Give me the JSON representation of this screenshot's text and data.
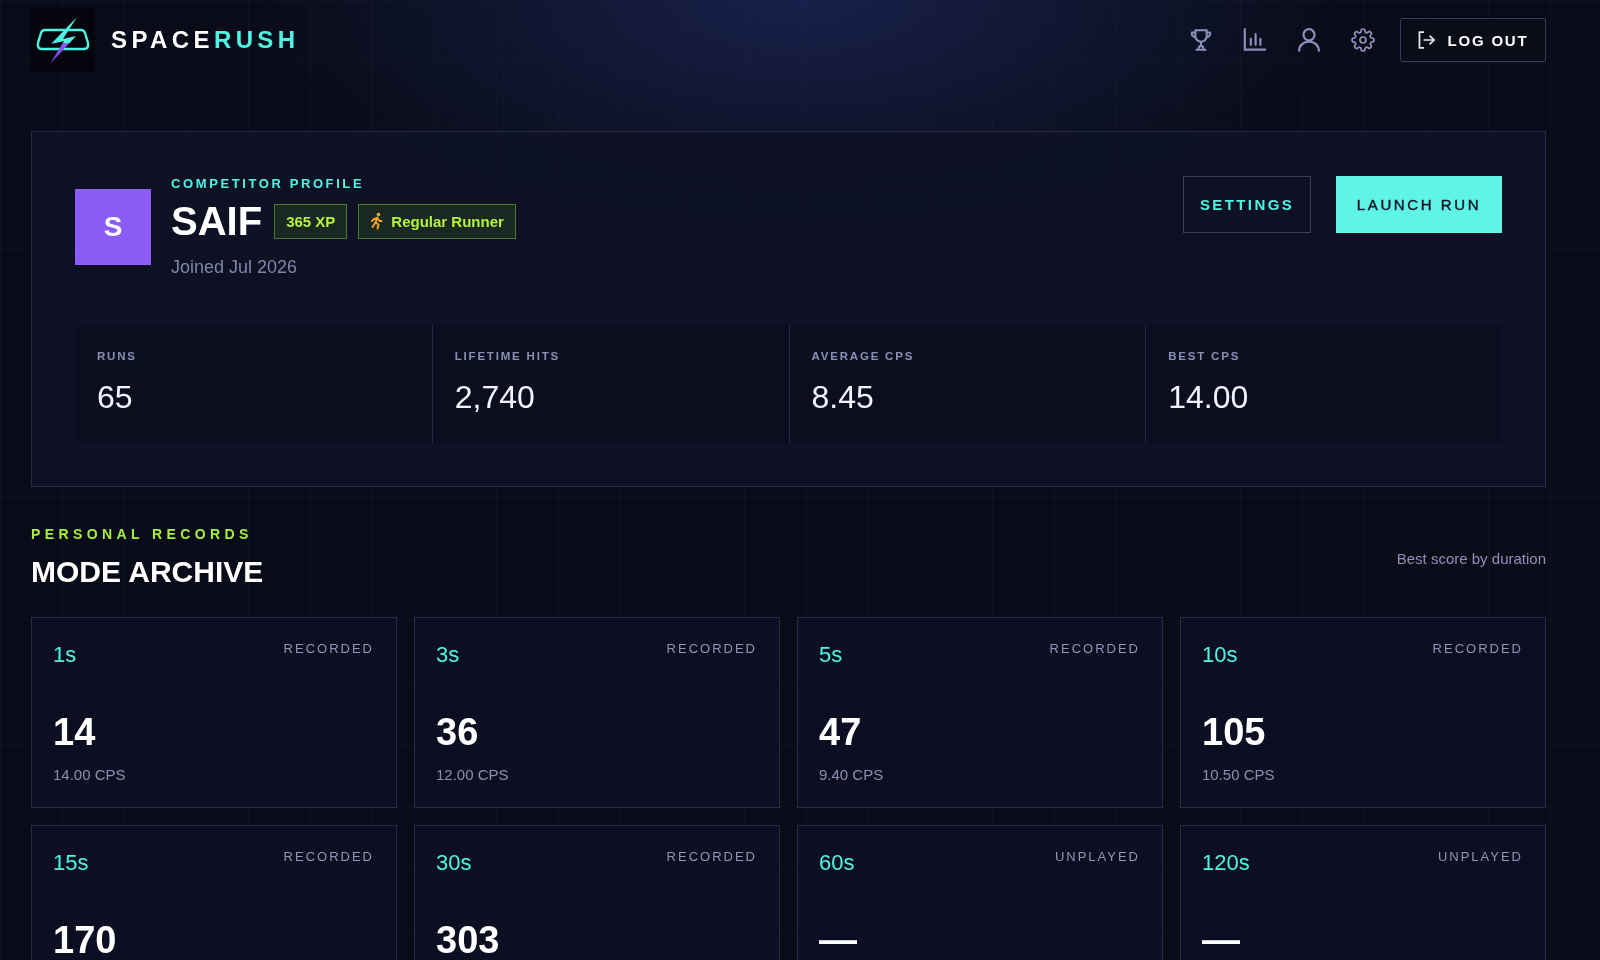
{
  "header": {
    "brand": [
      {
        "text": "SPACE",
        "accent": false
      },
      {
        "text": "RUSH",
        "accent": true
      }
    ],
    "logout_button": "LOG OUT"
  },
  "profile": {
    "eyebrow": "COMPETITOR PROFILE",
    "avatar_initial": "S",
    "name": "SAIF",
    "badges": [
      {
        "kind": "xp",
        "label": "365 XP"
      },
      {
        "kind": "rank",
        "label": "Regular Runner"
      }
    ],
    "joined": "Joined Jul 2026",
    "buttons": [
      {
        "kind": "secondary",
        "label": "SETTINGS"
      },
      {
        "kind": "primary",
        "label": "LAUNCH RUN"
      }
    ],
    "stats": [
      {
        "label": "RUNS",
        "value": "65"
      },
      {
        "label": "LIFETIME HITS",
        "value": "2,740"
      },
      {
        "label": "AVERAGE CPS",
        "value": "8.45"
      },
      {
        "label": "BEST CPS",
        "value": "14.00"
      }
    ]
  },
  "records": {
    "eyebrow": "PERSONAL RECORDS",
    "title": "MODE ARCHIVE",
    "note": "Best score by duration",
    "modes": [
      {
        "duration": "1s",
        "status": "RECORDED",
        "score": "14",
        "cps": "14.00 CPS"
      },
      {
        "duration": "3s",
        "status": "RECORDED",
        "score": "36",
        "cps": "12.00 CPS"
      },
      {
        "duration": "5s",
        "status": "RECORDED",
        "score": "47",
        "cps": "9.40 CPS"
      },
      {
        "duration": "10s",
        "status": "RECORDED",
        "score": "105",
        "cps": "10.50 CPS"
      },
      {
        "duration": "15s",
        "status": "RECORDED",
        "score": "170"
      },
      {
        "duration": "30s",
        "status": "RECORDED",
        "score": "303"
      },
      {
        "duration": "60s",
        "status": "UNPLAYED",
        "score": "—"
      },
      {
        "duration": "120s",
        "status": "UNPLAYED",
        "score": "—"
      }
    ]
  }
}
